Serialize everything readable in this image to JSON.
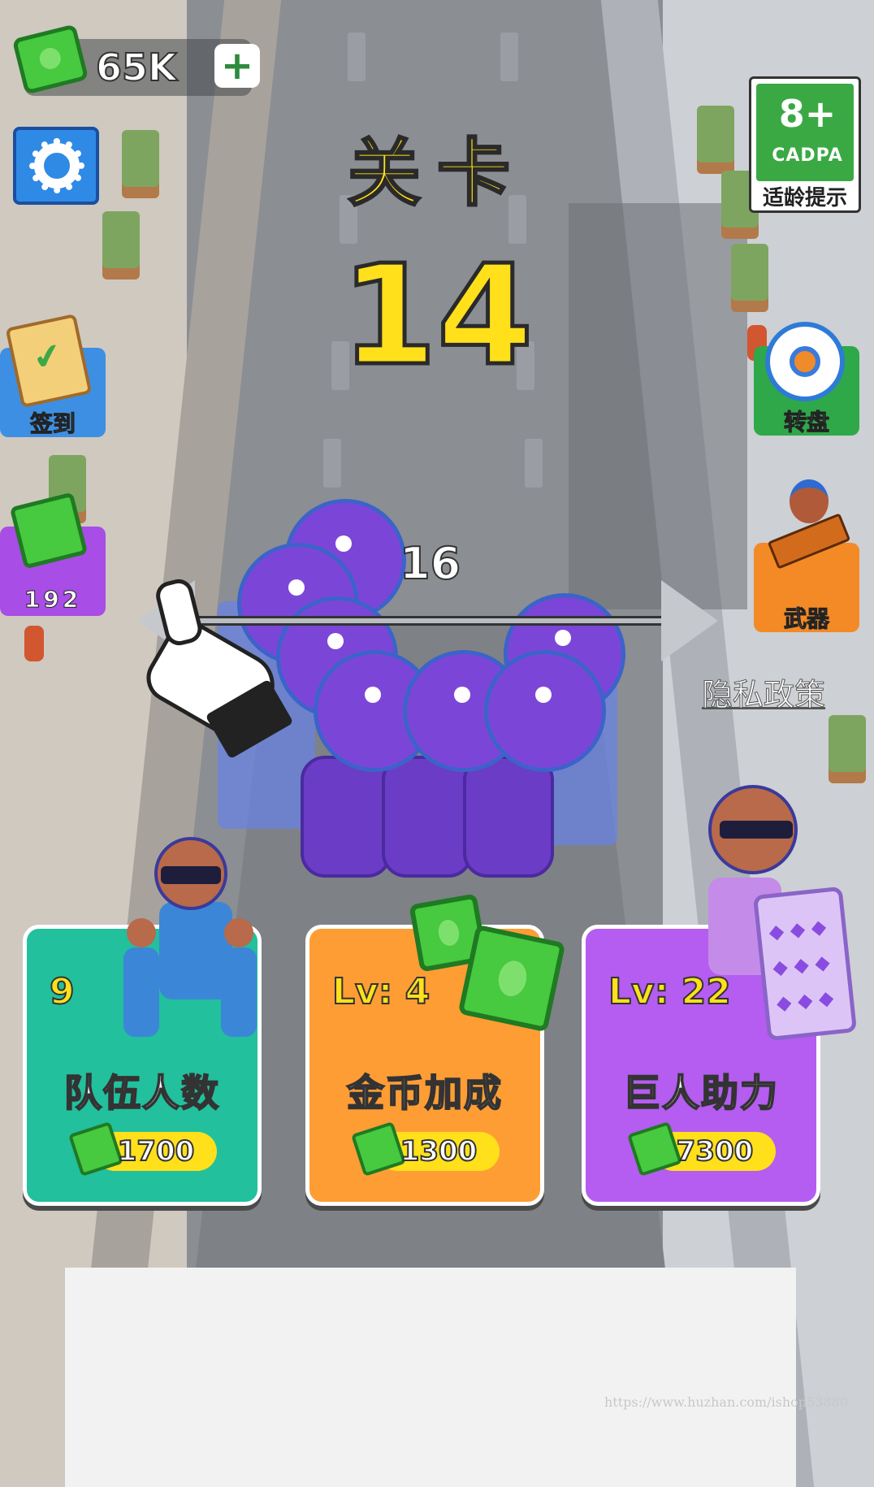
{
  "hud": {
    "money": "65K",
    "plus_label": "+",
    "age_rating": "8+",
    "age_org": "CADPA",
    "age_hint": "适龄提示"
  },
  "level": {
    "title": "关卡",
    "number": "14"
  },
  "side_buttons": {
    "checkin_label": "签到",
    "wheel_label": "转盘",
    "cash_amount": "192",
    "weapon_label": "武器"
  },
  "privacy_link": "隐私政策",
  "crowd": {
    "count": "16"
  },
  "upgrades": [
    {
      "level": "9",
      "title": "队伍人数",
      "price": "1700",
      "color": "#22c09d"
    },
    {
      "level": "Lv: 4",
      "title": "金币加成",
      "price": "1300",
      "color": "#ff9d35"
    },
    {
      "level": "Lv: 22",
      "title": "巨人助力",
      "price": "7300",
      "color": "#b45df0"
    }
  ],
  "watermark": "https://www.huzhan.com/ishop53880",
  "icons": {
    "money": "cash-stack-icon",
    "settings": "gear-icon",
    "checkin": "clipboard-check-icon",
    "wheel": "prize-wheel-icon",
    "weapon": "gun-icon",
    "drag": "hand-pointer-icon"
  }
}
